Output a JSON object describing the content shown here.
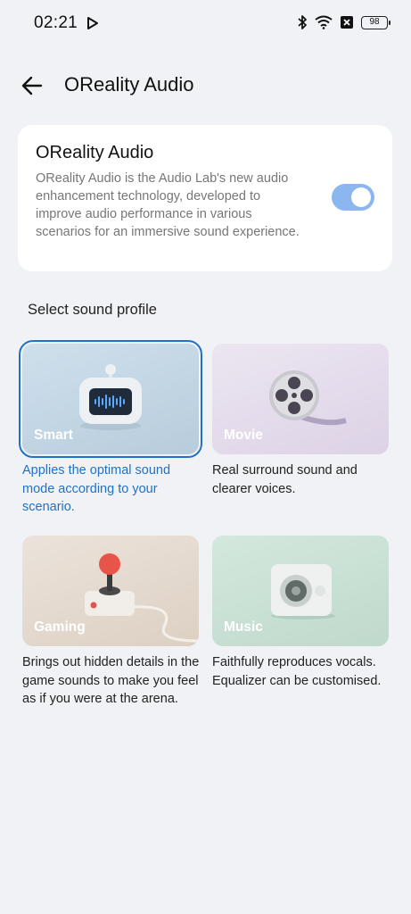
{
  "status_bar": {
    "time": "02:21",
    "battery": "98",
    "icons": [
      "play-store-icon",
      "bluetooth-icon",
      "wifi-icon",
      "sim-off-icon",
      "battery-icon"
    ]
  },
  "header": {
    "title": "OReality Audio",
    "back_icon": "arrow-left-icon"
  },
  "feature": {
    "title": "OReality Audio",
    "description": "OReality Audio is the Audio Lab's new audio enhancement technology, developed to improve audio performance in various scenarios for an immersive sound experience.",
    "enabled": true,
    "toggle_color": "#8bb6ef"
  },
  "profiles_section": {
    "label": "Select sound profile",
    "accent_color": "#1f72c8",
    "items": [
      {
        "name": "Smart",
        "description": "Applies the optimal sound mode according to your scenario.",
        "selected": true
      },
      {
        "name": "Movie",
        "description": "Real surround sound and clearer voices.",
        "selected": false
      },
      {
        "name": "Gaming",
        "description": "Brings out hidden details in the game sounds to make you feel as if you were at the arena.",
        "selected": false
      },
      {
        "name": "Music",
        "description": "Faithfully reproduces vocals. Equalizer can be customised.",
        "selected": false
      }
    ]
  }
}
